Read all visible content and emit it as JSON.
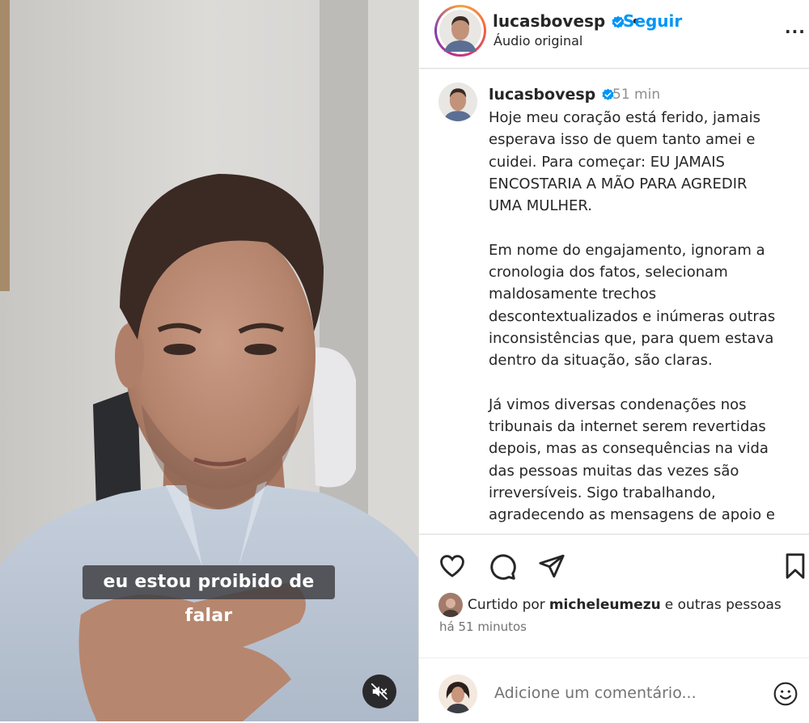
{
  "video": {
    "subtitle": "eu estou proibido de falar",
    "mute_icon": "speaker-muted-icon"
  },
  "header": {
    "username": "lucasbovesp",
    "separator": "•",
    "follow_label": "Seguir",
    "audio_label": "Áudio original",
    "more_label": "..."
  },
  "post": {
    "username": "lucasbovesp",
    "time": "51 min",
    "caption": [
      "Hoje meu coração está ferido, jamais esperava isso de quem tanto amei e cuidei. Para começar: EU JAMAIS ENCOSTARIA A MÃO PARA AGREDIR UMA MULHER.",
      "Em nome do engajamento, ignoram a cronologia dos fatos, selecionam maldosamente trechos descontextualizados e inúmeras outras inconsistências que, para quem estava dentro da situação, são claras.",
      "Já vimos diversas condenações nos tribunais da internet serem revertidas depois, mas as consequências na vida das pessoas muitas das vezes são irreversíveis. Sigo trabalhando, agradecendo as mensagens de apoio e"
    ]
  },
  "actions": {
    "liked_prefix": "Curtido por",
    "liked_user": "micheleumezu",
    "liked_suffix": "e outras pessoas",
    "time_ago": "há 51 minutos"
  },
  "comment": {
    "placeholder": "Adicione um comentário..."
  },
  "colors": {
    "accent": "#0095f6",
    "text": "#262626",
    "muted": "#737373",
    "verified": "#0095f6"
  }
}
